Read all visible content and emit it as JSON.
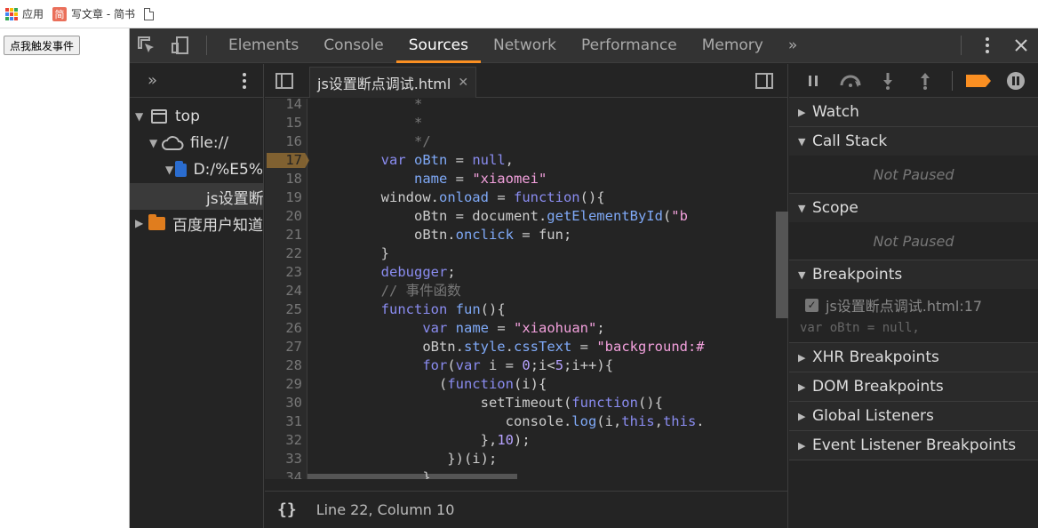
{
  "bookmarks": {
    "apps_label": "应用",
    "jianshu_label": "写文章 - 简书",
    "jianshu_icon_text": "简"
  },
  "page": {
    "button_label": "点我触发事件"
  },
  "devtools": {
    "tabs": [
      "Elements",
      "Console",
      "Sources",
      "Network",
      "Performance",
      "Memory"
    ],
    "active_tab": "Sources",
    "more_tabs": "»"
  },
  "navigator": {
    "more": "»",
    "tree": [
      {
        "label": "top"
      },
      {
        "label": "file://"
      },
      {
        "label": "D:/%E5%"
      },
      {
        "label": "js设置断点调试.html"
      },
      {
        "label": "百度用户知道"
      }
    ]
  },
  "editor": {
    "open_file": "js设置断点调试.html",
    "status": "Line 22, Column 10",
    "braces": "{}",
    "lines": [
      {
        "num": "14",
        "html": "<span class=\"c\">            *</span>"
      },
      {
        "num": "15",
        "html": "<span class=\"c\">            *</span>"
      },
      {
        "num": "16",
        "html": "<span class=\"c\">            */</span>"
      },
      {
        "num": "17",
        "html": "        <span class=\"k\">var</span> <span class=\"p\">oBtn</span> = <span class=\"k\">null</span>,",
        "bp": true
      },
      {
        "num": "18",
        "html": "            <span class=\"p\">name</span> = <span class=\"s\">\"xiaomei\"</span>"
      },
      {
        "num": "19",
        "html": "        window.<span class=\"p\">onload</span> = <span class=\"k\">function</span>(){"
      },
      {
        "num": "20",
        "html": "            oBtn = document.<span class=\"p\">getElementById</span>(<span class=\"s\">\"b</span>"
      },
      {
        "num": "21",
        "html": "            oBtn.<span class=\"p\">onclick</span> = fun;"
      },
      {
        "num": "22",
        "html": "        }"
      },
      {
        "num": "23",
        "html": "        <span class=\"k\">debugger</span>;"
      },
      {
        "num": "24",
        "html": "<span class=\"c\">        // 事件函数</span>"
      },
      {
        "num": "25",
        "html": "        <span class=\"k\">function</span> <span class=\"p\">fun</span>(){"
      },
      {
        "num": "26",
        "html": "             <span class=\"k\">var</span> <span class=\"p\">name</span> = <span class=\"s\">\"xiaohuan\"</span>;"
      },
      {
        "num": "27",
        "html": "             oBtn.<span class=\"p\">style</span>.<span class=\"p\">cssText</span> = <span class=\"s\">\"background:#</span>"
      },
      {
        "num": "28",
        "html": "             <span class=\"k\">for</span>(<span class=\"k\">var</span> i = <span class=\"n\">0</span>;i&lt;<span class=\"n\">5</span>;i++){"
      },
      {
        "num": "29",
        "html": "               (<span class=\"k\">function</span>(i){"
      },
      {
        "num": "30",
        "html": "                    setTimeout(<span class=\"k\">function</span>(){"
      },
      {
        "num": "31",
        "html": "                       console.<span class=\"p\">log</span>(i,<span class=\"k\">this</span>,<span class=\"k\">this</span>."
      },
      {
        "num": "32",
        "html": "                    },<span class=\"n\">10</span>);"
      },
      {
        "num": "33",
        "html": "                })(i);"
      },
      {
        "num": "34",
        "html": "             }"
      }
    ]
  },
  "debugger": {
    "sections": [
      {
        "title": "Watch"
      },
      {
        "title": "Call Stack",
        "body": "Not Paused"
      },
      {
        "title": "Scope",
        "body": "Not Paused"
      },
      {
        "title": "Breakpoints"
      },
      {
        "title": "XHR Breakpoints"
      },
      {
        "title": "DOM Breakpoints"
      },
      {
        "title": "Global Listeners"
      },
      {
        "title": "Event Listener Breakpoints"
      }
    ],
    "breakpoint": {
      "label": "js设置断点调试.html:17",
      "code": "var oBtn = null,"
    }
  },
  "colors": {
    "accent": "#fa8f22",
    "breakpoint": "#e8a33a",
    "keyword": "#8a8cf0",
    "string": "#f2a0dc"
  }
}
